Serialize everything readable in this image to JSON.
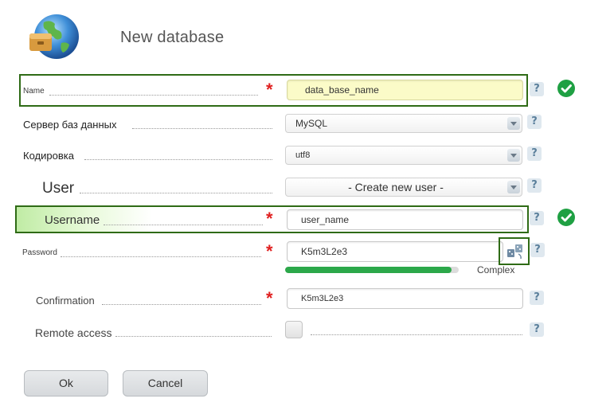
{
  "title": "New database",
  "fields": {
    "name": {
      "label": "Name",
      "value": "data_base_name"
    },
    "server": {
      "label": "Сервер баз данных",
      "value": "MySQL"
    },
    "encoding": {
      "label": "Кодировка",
      "value": "utf8"
    },
    "user": {
      "label": "User",
      "value": "- Create new user -"
    },
    "username": {
      "label": "Username",
      "value": "user_name"
    },
    "password": {
      "label": "Password",
      "value": "K5m3L2e3",
      "strength_label": "Complex",
      "strength_fraction": 0.96
    },
    "confirmation": {
      "label": "Confirmation",
      "value": "K5m3L2e3"
    },
    "remote_access": {
      "label": "Remote access",
      "checked": false
    }
  },
  "required_mark": "*",
  "help_mark": "?",
  "buttons": {
    "ok": "Ok",
    "cancel": "Cancel"
  },
  "icons": {
    "logo": "database-globe-icon",
    "valid": "checkmark-circle-icon",
    "generate": "generate-password-icon",
    "dropdown": "chevron-down-icon"
  },
  "colors": {
    "valid_green": "#1fa043",
    "required_red": "#e02020",
    "strength_bar": "#2ca84a",
    "highlight_border": "#2f6b16"
  }
}
